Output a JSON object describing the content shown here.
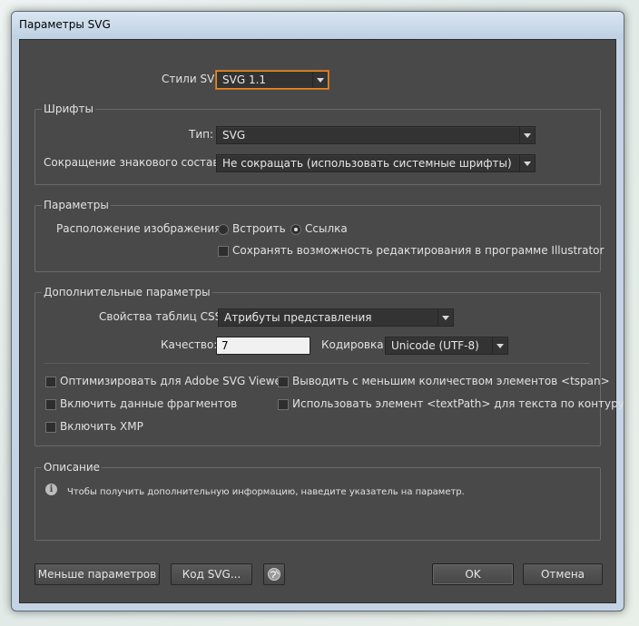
{
  "window": {
    "title": "Параметры SVG"
  },
  "svg_style": {
    "label": "Стили SVG:",
    "value": "SVG 1.1"
  },
  "fonts": {
    "group_title": "Шрифты",
    "type_label": "Тип:",
    "type_value": "SVG",
    "subset_label": "Сокращение знакового состава:",
    "subset_value": "Не сокращать (использовать системные шрифты)"
  },
  "options": {
    "group_title": "Параметры",
    "image_location_label": "Расположение изображения:",
    "embed_label": "Встроить",
    "link_label": "Ссылка",
    "selected": "link",
    "preserve_label": "Сохранять возможность редактирования в программе Illustrator",
    "preserve_checked": false
  },
  "advanced": {
    "group_title": "Дополнительные параметры",
    "css_label": "Свойства таблиц CSS:",
    "css_value": "Атрибуты представления",
    "quality_label": "Качество:",
    "quality_value": "7",
    "encoding_label": "Кодировка:",
    "encoding_value": "Unicode (UTF-8)",
    "optimize_label": "Оптимизировать для Adobe SVG Viewer",
    "fragments_label": "Включить данные фрагментов",
    "xmp_label": "Включить XMP",
    "tspan_label": "Выводить с меньшим количеством элементов <tspan>",
    "textpath_label": "Использовать элемент <textPath> для текста по контуру"
  },
  "description": {
    "group_title": "Описание",
    "text": "Чтобы получить дополнительную информацию, наведите указатель на параметр."
  },
  "buttons": {
    "fewer": "Меньше параметров",
    "svg_code": "Код SVG...",
    "ok": "OK",
    "cancel": "Отмена"
  },
  "icons": {
    "info": "info-icon",
    "globe": "globe-icon"
  },
  "colors": {
    "dialog_bg": "#494949",
    "focus_border": "#e48b2b"
  }
}
